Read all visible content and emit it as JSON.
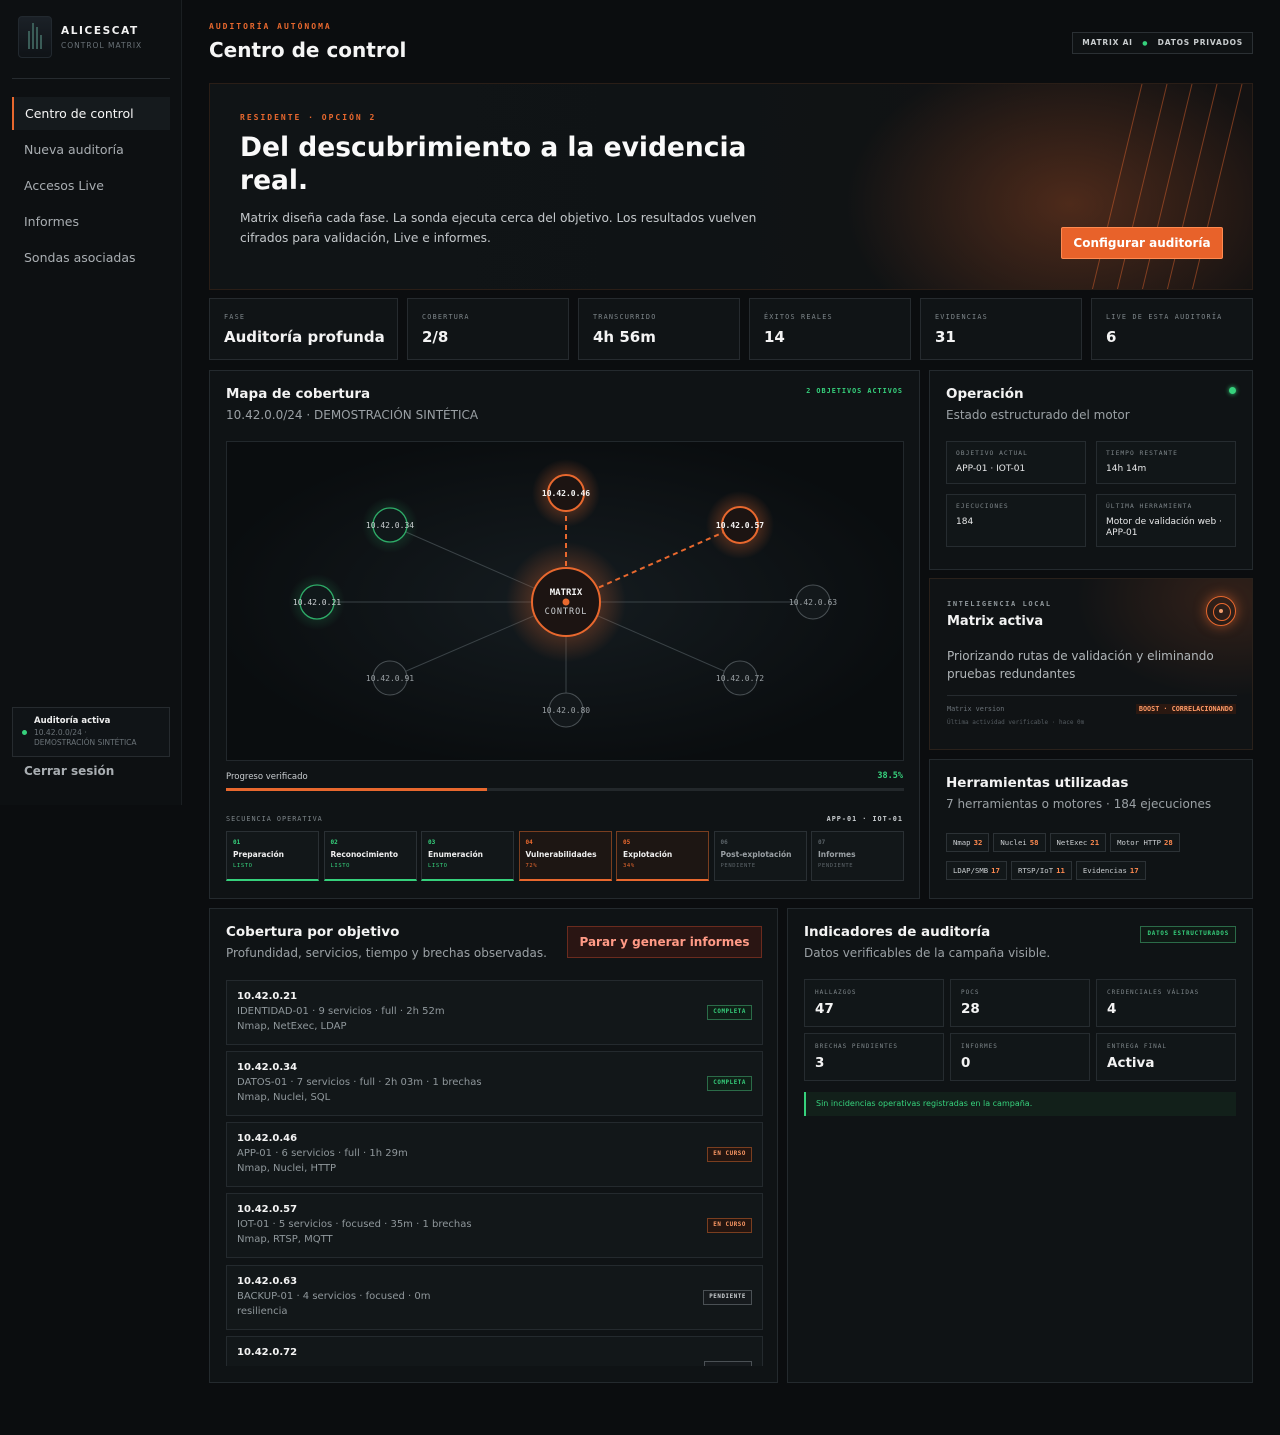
{
  "sidebar": {
    "brand_name": "ALICESCAT",
    "brand_sub": "CONTROL MATRIX",
    "nav": [
      {
        "label": "Centro de control",
        "active": true
      },
      {
        "label": "Nueva auditoría"
      },
      {
        "label": "Accesos Live"
      },
      {
        "label": "Informes"
      },
      {
        "label": "Sondas asociadas"
      }
    ],
    "audit": {
      "title": "Auditoría activa",
      "line1": "10.42.0.0/24 ·",
      "line2": "DEMOSTRACIÓN SINTÉTICA"
    },
    "logout": "Cerrar sesión"
  },
  "header": {
    "eyebrow": "AUDITORÍA AUTÓNOMA",
    "title": "Centro de control",
    "chip_left": "MATRIX AI",
    "chip_sep": "●",
    "chip_right": "DATOS PRIVADOS"
  },
  "hero": {
    "eyebrow": "RESIDENTE · OPCIÓN 2",
    "title": "Del descubrimiento a la evidencia real.",
    "desc": "Matrix diseña cada fase. La sonda ejecuta cerca del objetivo. Los resultados vuelven cifrados para validación, Live e informes.",
    "button": "Configurar auditoría"
  },
  "stats": [
    {
      "label": "FASE",
      "value": "Auditoría profunda"
    },
    {
      "label": "COBERTURA",
      "value": "2/8"
    },
    {
      "label": "TRANSCURRIDO",
      "value": "4h 56m"
    },
    {
      "label": "ÉXITOS REALES",
      "value": "14"
    },
    {
      "label": "EVIDENCIAS",
      "value": "31"
    },
    {
      "label": "LIVE DE ESTA AUDITORÍA",
      "value": "6"
    }
  ],
  "map": {
    "title": "Mapa de cobertura",
    "subtitle": "10.42.0.0/24 · DEMOSTRACIÓN SINTÉTICA",
    "badge": "2 OBJETIVOS ACTIVOS",
    "center_line1": "MATRIX",
    "center_line2": "CONTROL",
    "nodes": [
      {
        "ip": "10.42.0.46",
        "state": "active"
      },
      {
        "ip": "10.42.0.34",
        "state": "done"
      },
      {
        "ip": "10.42.0.57",
        "state": "active"
      },
      {
        "ip": "10.42.0.21",
        "state": "done"
      },
      {
        "ip": "10.42.0.63",
        "state": "pending"
      },
      {
        "ip": "10.42.0.91",
        "state": "pending"
      },
      {
        "ip": "10.42.0.72",
        "state": "pending"
      },
      {
        "ip": "10.42.0.80",
        "state": "pending"
      }
    ],
    "progress_label": "Progreso verificado",
    "progress_text": "38.5%",
    "progress_value": 0.385,
    "sequence_label": "SECUENCIA OPERATIVA",
    "sequence_right": "APP-01 · IOT-01",
    "steps": [
      {
        "num": "01",
        "title": "Preparación",
        "status": "LISTO",
        "state": "done"
      },
      {
        "num": "02",
        "title": "Reconocimiento",
        "status": "LISTO",
        "state": "done"
      },
      {
        "num": "03",
        "title": "Enumeración",
        "status": "LISTO",
        "state": "done"
      },
      {
        "num": "04",
        "title": "Vulnerabilidades",
        "status": "72%",
        "state": "act"
      },
      {
        "num": "05",
        "title": "Explotación",
        "status": "34%",
        "state": "act"
      },
      {
        "num": "06",
        "title": "Post-explotación",
        "status": "PENDIENTE",
        "state": "pend"
      },
      {
        "num": "07",
        "title": "Informes",
        "status": "PENDIENTE",
        "state": "pend"
      }
    ]
  },
  "operation": {
    "title": "Operación",
    "subtitle": "Estado estructurado del motor",
    "cards": [
      {
        "label": "OBJETIVO ACTUAL",
        "value": "APP-01 · IOT-01"
      },
      {
        "label": "TIEMPO RESTANTE",
        "value": "14h 14m"
      },
      {
        "label": "EJECUCIONES",
        "value": "184"
      },
      {
        "label": "ÚLTIMA HERRAMIENTA",
        "value": "Motor de validación web · APP-01"
      }
    ]
  },
  "intel": {
    "eyebrow": "INTELIGENCIA LOCAL",
    "title": "Matrix activa",
    "desc": "Priorizando rutas de validación y eliminando pruebas redundantes",
    "version": "Matrix version",
    "activity": "Última actividad verificable · hace 0m",
    "badge": "BOOST · CORRELACIONANDO"
  },
  "tools": {
    "title": "Herramientas utilizadas",
    "subtitle": "7 herramientas o motores · 184 ejecuciones",
    "items": [
      {
        "name": "Nmap",
        "count": "32"
      },
      {
        "name": "Nuclei",
        "count": "58"
      },
      {
        "name": "NetExec",
        "count": "21"
      },
      {
        "name": "Motor HTTP",
        "count": "28"
      },
      {
        "name": "LDAP/SMB",
        "count": "17"
      },
      {
        "name": "RTSP/IoT",
        "count": "11"
      },
      {
        "name": "Evidencias",
        "count": "17"
      }
    ]
  },
  "coverage": {
    "title": "Cobertura por objetivo",
    "subtitle": "Profundidad, servicios, tiempo y brechas observadas.",
    "button": "Parar y generar informes",
    "targets": [
      {
        "ip": "10.42.0.21",
        "detail": "IDENTIDAD-01 · 9 servicios · full · 2h 52m",
        "tools": "Nmap, NetExec, LDAP",
        "status": "COMPLETA",
        "kind": "ok"
      },
      {
        "ip": "10.42.0.34",
        "detail": "DATOS-01 · 7 servicios · full · 2h 03m · 1 brechas",
        "tools": "Nmap, Nuclei, SQL",
        "status": "COMPLETA",
        "kind": "ok"
      },
      {
        "ip": "10.42.0.46",
        "detail": "APP-01 · 6 servicios · full · 1h 29m",
        "tools": "Nmap, Nuclei, HTTP",
        "status": "EN CURSO",
        "kind": "run"
      },
      {
        "ip": "10.42.0.57",
        "detail": "IOT-01 · 5 servicios · focused · 35m · 1 brechas",
        "tools": "Nmap, RTSP, MQTT",
        "status": "EN CURSO",
        "kind": "run"
      },
      {
        "ip": "10.42.0.63",
        "detail": "BACKUP-01 · 4 servicios · focused · 0m",
        "tools": "resiliencia",
        "status": "PENDIENTE",
        "kind": "pend"
      },
      {
        "ip": "10.42.0.72",
        "detail": "",
        "tools": "",
        "status": "",
        "kind": "pend"
      }
    ]
  },
  "indicators": {
    "title": "Indicadores de auditoría",
    "subtitle": "Datos verificables de la campaña visible.",
    "badge": "DATOS ESTRUCTURADOS",
    "cards": [
      {
        "label": "HALLAZGOS",
        "value": "47"
      },
      {
        "label": "POCS",
        "value": "28"
      },
      {
        "label": "CREDENCIALES VÁLIDAS",
        "value": "4"
      },
      {
        "label": "BRECHAS PENDIENTES",
        "value": "3"
      },
      {
        "label": "INFORMES",
        "value": "0"
      },
      {
        "label": "ENTREGA FINAL",
        "value": "Activa"
      }
    ],
    "banner": "Sin incidencias operativas registradas en la campaña."
  },
  "colors": {
    "accent": "#e8682e",
    "success": "#36d17c",
    "background": "#0b0d0f"
  }
}
